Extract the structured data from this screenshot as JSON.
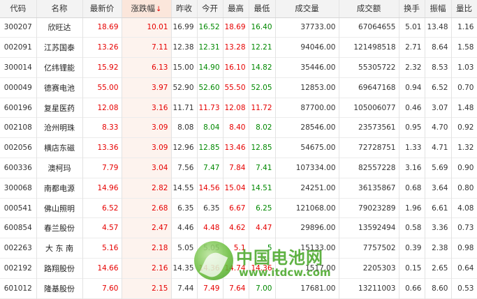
{
  "headers": [
    "代码",
    "名称",
    "最新价",
    "涨跌幅",
    "昨收",
    "今开",
    "最高",
    "最低",
    "成交量",
    "成交额",
    "换手",
    "振幅",
    "量比"
  ],
  "sorted_column": "涨跌幅",
  "rows": [
    {
      "code": "300207",
      "name": "欣旺达",
      "latest": "18.69",
      "change": "10.01",
      "prev": "16.99",
      "open": "16.52",
      "high": "18.69",
      "low": "16.40",
      "volume": "37733.00",
      "amount": "67064655",
      "turnover": "5.01",
      "amplitude": "13.48",
      "ratio": "1.16"
    },
    {
      "code": "002091",
      "name": "江苏国泰",
      "latest": "13.26",
      "change": "7.11",
      "prev": "12.38",
      "open": "12.31",
      "high": "13.28",
      "low": "12.21",
      "volume": "94046.00",
      "amount": "121498518",
      "turnover": "2.71",
      "amplitude": "8.64",
      "ratio": "1.58"
    },
    {
      "code": "300014",
      "name": "亿纬锂能",
      "latest": "15.92",
      "change": "6.13",
      "prev": "15.00",
      "open": "14.90",
      "high": "16.10",
      "low": "14.82",
      "volume": "35446.00",
      "amount": "55305722",
      "turnover": "2.32",
      "amplitude": "8.53",
      "ratio": "1.03"
    },
    {
      "code": "000049",
      "name": "德赛电池",
      "latest": "55.00",
      "change": "3.97",
      "prev": "52.90",
      "open": "52.60",
      "high": "55.50",
      "low": "52.05",
      "volume": "12853.00",
      "amount": "69647168",
      "turnover": "0.94",
      "amplitude": "6.52",
      "ratio": "0.70"
    },
    {
      "code": "600196",
      "name": "复星医药",
      "latest": "12.08",
      "change": "3.16",
      "prev": "11.71",
      "open": "11.73",
      "high": "12.08",
      "low": "11.72",
      "volume": "87700.00",
      "amount": "105006077",
      "turnover": "0.46",
      "amplitude": "3.07",
      "ratio": "1.48"
    },
    {
      "code": "002108",
      "name": "沧州明珠",
      "latest": "8.33",
      "change": "3.09",
      "prev": "8.08",
      "open": "8.04",
      "high": "8.40",
      "low": "8.02",
      "volume": "28546.00",
      "amount": "23573561",
      "turnover": "0.95",
      "amplitude": "4.70",
      "ratio": "0.92"
    },
    {
      "code": "002056",
      "name": "横店东磁",
      "latest": "13.36",
      "change": "3.09",
      "prev": "12.96",
      "open": "12.85",
      "high": "13.46",
      "low": "12.85",
      "volume": "54675.00",
      "amount": "72728751",
      "turnover": "1.33",
      "amplitude": "4.71",
      "ratio": "1.32"
    },
    {
      "code": "600336",
      "name": "澳柯玛",
      "latest": "7.79",
      "change": "3.04",
      "prev": "7.56",
      "open": "7.47",
      "high": "7.84",
      "low": "7.41",
      "volume": "107334.00",
      "amount": "82557228",
      "turnover": "3.16",
      "amplitude": "5.69",
      "ratio": "0.90"
    },
    {
      "code": "300068",
      "name": "南都电源",
      "latest": "14.96",
      "change": "2.82",
      "prev": "14.55",
      "open": "14.56",
      "high": "15.04",
      "low": "14.51",
      "volume": "24251.00",
      "amount": "36135867",
      "turnover": "0.68",
      "amplitude": "3.64",
      "ratio": "0.80"
    },
    {
      "code": "000541",
      "name": "佛山照明",
      "latest": "6.52",
      "change": "2.68",
      "prev": "6.35",
      "open": "6.35",
      "high": "6.67",
      "low": "6.25",
      "volume": "121068.00",
      "amount": "79023289",
      "turnover": "1.96",
      "amplitude": "6.61",
      "ratio": "4.08"
    },
    {
      "code": "600854",
      "name": "春兰股份",
      "latest": "4.57",
      "change": "2.47",
      "prev": "4.46",
      "open": "4.48",
      "high": "4.62",
      "low": "4.47",
      "volume": "29896.00",
      "amount": "13592494",
      "turnover": "0.58",
      "amplitude": "3.36",
      "ratio": "0.73"
    },
    {
      "code": "002263",
      "name": "大 东 南",
      "latest": "5.16",
      "change": "2.18",
      "prev": "5.05",
      "open": "5.05",
      "high": "5.1",
      "low": "5",
      "volume": "15133.00",
      "amount": "7757502",
      "turnover": "0.39",
      "amplitude": "2.38",
      "ratio": "0.98"
    },
    {
      "code": "002192",
      "name": "路翔股份",
      "latest": "14.66",
      "change": "2.16",
      "prev": "14.35",
      "open": "14.36",
      "high": "14.74",
      "low": "14.36",
      "volume": "1517.00",
      "amount": "2205303",
      "turnover": "0.15",
      "amplitude": "2.65",
      "ratio": "0.64"
    },
    {
      "code": "601012",
      "name": "隆基股份",
      "latest": "7.60",
      "change": "2.15",
      "prev": "7.44",
      "open": "7.49",
      "high": "7.64",
      "low": "7.00",
      "volume": "17681.00",
      "amount": "13211003",
      "turnover": "0.66",
      "amplitude": "8.60",
      "ratio": "0.53"
    }
  ],
  "watermark": {
    "title": "中国电池网",
    "url": "www.itdcw.com"
  },
  "colors": {
    "up": "#e60000",
    "down": "#008800",
    "flat": "#333333",
    "sorted_bg": "#fdf3ee"
  }
}
